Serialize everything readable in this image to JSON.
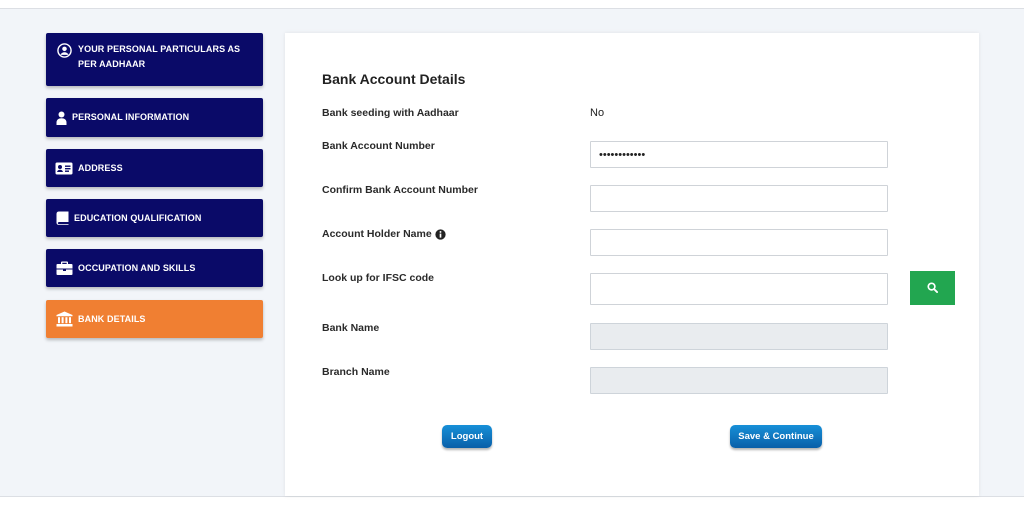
{
  "sidebar": {
    "items": [
      {
        "label": "YOUR PERSONAL PARTICULARS AS PER AADHAAR",
        "icon": "user-circle-icon",
        "active": false
      },
      {
        "label": "PERSONAL INFORMATION",
        "icon": "person-icon",
        "active": false
      },
      {
        "label": "ADDRESS",
        "icon": "id-card-icon",
        "active": false
      },
      {
        "label": "EDUCATION QUALIFICATION",
        "icon": "book-icon",
        "active": false
      },
      {
        "label": "OCCUPATION AND SKILLS",
        "icon": "briefcase-icon",
        "active": false
      },
      {
        "label": "BANK DETAILS",
        "icon": "bank-icon",
        "active": true
      }
    ]
  },
  "form": {
    "title": "Bank Account Details",
    "seeding": {
      "label": "Bank seeding with Aadhaar",
      "value": "No"
    },
    "account_number": {
      "label": "Bank Account Number",
      "value": "••••••••••••"
    },
    "confirm_account_number": {
      "label": "Confirm Bank Account Number",
      "value": ""
    },
    "holder_name": {
      "label": "Account Holder Name",
      "value": ""
    },
    "ifsc_lookup": {
      "label": "Look up for IFSC code",
      "value": ""
    },
    "bank_name": {
      "label": "Bank Name",
      "value": ""
    },
    "branch_name": {
      "label": "Branch Name",
      "value": ""
    }
  },
  "actions": {
    "logout_label": "Logout",
    "save_label": "Save & Continue"
  },
  "colors": {
    "sidebar_bg": "#0a0a68",
    "sidebar_active": "#f07f32",
    "search_button": "#22a650",
    "action_button": "#0f78c8"
  }
}
